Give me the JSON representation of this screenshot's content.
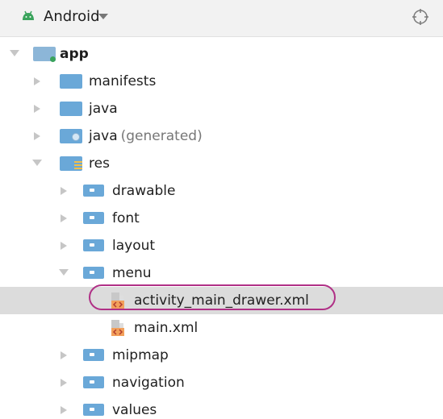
{
  "header": {
    "title": "Android",
    "view_selector_icon": "android-icon",
    "dropdown_icon": "chevron-down-icon",
    "locate_icon": "crosshair-icon"
  },
  "tree": {
    "items": [
      {
        "label": "app",
        "type": "module",
        "state": "expanded"
      },
      {
        "label": "manifests",
        "type": "folder",
        "state": "collapsed"
      },
      {
        "label": "java",
        "type": "folder",
        "state": "collapsed"
      },
      {
        "label": "java",
        "suffix": "(generated)",
        "type": "generated-folder",
        "state": "collapsed"
      },
      {
        "label": "res",
        "type": "resource-folder",
        "state": "expanded"
      },
      {
        "label": "drawable",
        "type": "folder",
        "state": "collapsed"
      },
      {
        "label": "font",
        "type": "folder",
        "state": "collapsed"
      },
      {
        "label": "layout",
        "type": "folder",
        "state": "collapsed"
      },
      {
        "label": "menu",
        "type": "folder",
        "state": "expanded"
      },
      {
        "label": "activity_main_drawer.xml",
        "type": "xml-file",
        "state": "selected"
      },
      {
        "label": "main.xml",
        "type": "xml-file",
        "state": "normal"
      },
      {
        "label": "mipmap",
        "type": "folder",
        "state": "collapsed"
      },
      {
        "label": "navigation",
        "type": "folder",
        "state": "collapsed"
      },
      {
        "label": "values",
        "type": "folder",
        "state": "collapsed"
      }
    ]
  },
  "colors": {
    "header_background": "#f2f2f2",
    "folder_blue": "#6aa8d8",
    "selection_background": "#dcdcdc",
    "highlight_outline": "#b03086",
    "android_green": "#3aa35c"
  }
}
